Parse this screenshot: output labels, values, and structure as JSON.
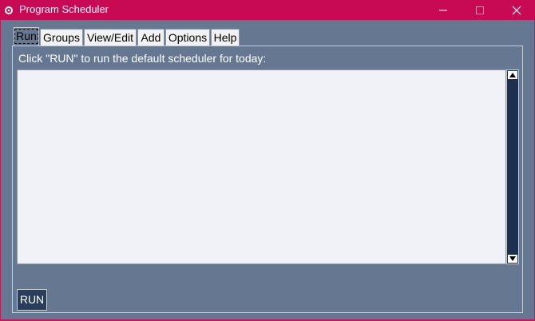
{
  "window": {
    "title": "Program Scheduler",
    "titlebar_color": "#c80a55"
  },
  "tabs": [
    {
      "label": "Run",
      "active": true
    },
    {
      "label": "Groups",
      "active": false
    },
    {
      "label": "View/Edit",
      "active": false
    },
    {
      "label": "Add",
      "active": false
    },
    {
      "label": "Options",
      "active": false
    },
    {
      "label": "Help",
      "active": false
    }
  ],
  "run_tab": {
    "instruction": "Click \"RUN\" to run the default scheduler for today:",
    "output_text": "",
    "run_label": "RUN"
  },
  "colors": {
    "background": "#667891",
    "text_area": "#f0f2f8",
    "scrollbar": "#1e3050",
    "button": "#2a3e5c"
  },
  "icons": {
    "app": "app-icon",
    "minimize": "minimize-icon",
    "maximize": "maximize-icon",
    "close": "close-icon",
    "scroll_up": "arrow-up-icon",
    "scroll_down": "arrow-down-icon"
  }
}
